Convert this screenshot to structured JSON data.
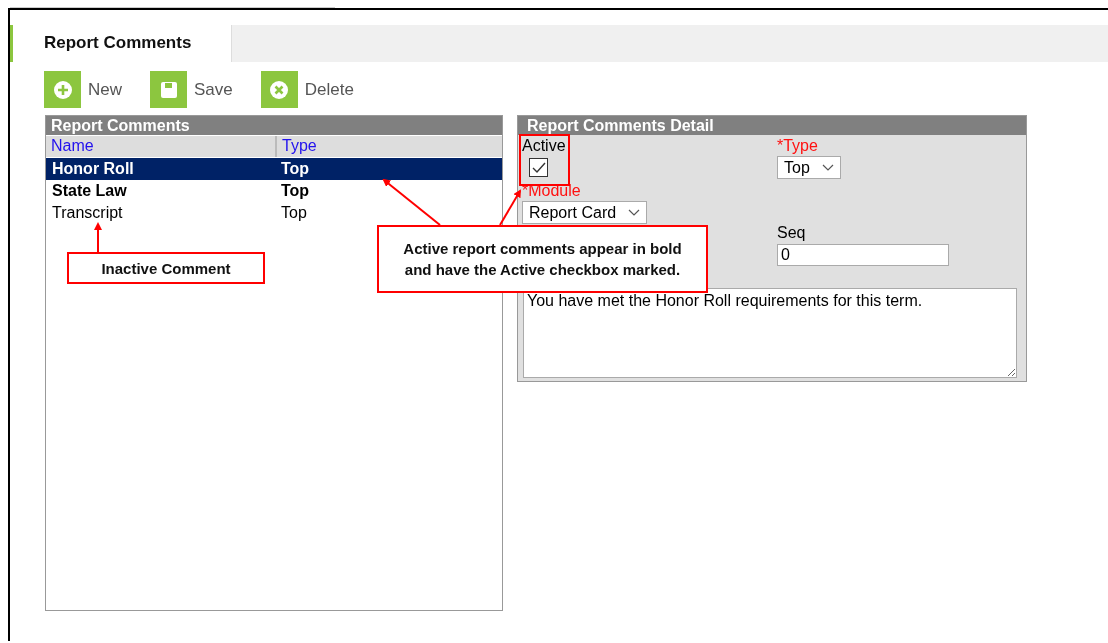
{
  "tab": {
    "label": "Report Comments",
    "selected": true
  },
  "toolbar": [
    {
      "kind": "new",
      "label": "New"
    },
    {
      "kind": "save",
      "label": "Save"
    },
    {
      "kind": "delete",
      "label": "Delete"
    }
  ],
  "list_panel": {
    "title": "Report Comments",
    "columns": [
      "Name",
      "Type"
    ],
    "rows": [
      {
        "name": "Honor Roll",
        "type": "Top",
        "active": true,
        "selected": true
      },
      {
        "name": "State Law",
        "type": "Top",
        "active": true,
        "selected": false
      },
      {
        "name": "Transcript",
        "type": "Top",
        "active": false,
        "selected": false
      }
    ]
  },
  "detail_panel": {
    "title": "Report Comments Detail",
    "active": {
      "label": "Active",
      "checked": true
    },
    "type": {
      "label": "*Type",
      "required": true,
      "value": "Top"
    },
    "module": {
      "label": "*Module",
      "required": true,
      "value": "Report Card"
    },
    "seq": {
      "label": "Seq",
      "required": false,
      "value": "0"
    },
    "comment": {
      "value": "You have met the Honor Roll requirements for this term."
    }
  },
  "annotations": [
    {
      "kind": "inactive",
      "text": "Inactive Comment"
    },
    {
      "kind": "active",
      "text": "Active report comments appear in bold and have the Active checkbox marked."
    }
  ]
}
